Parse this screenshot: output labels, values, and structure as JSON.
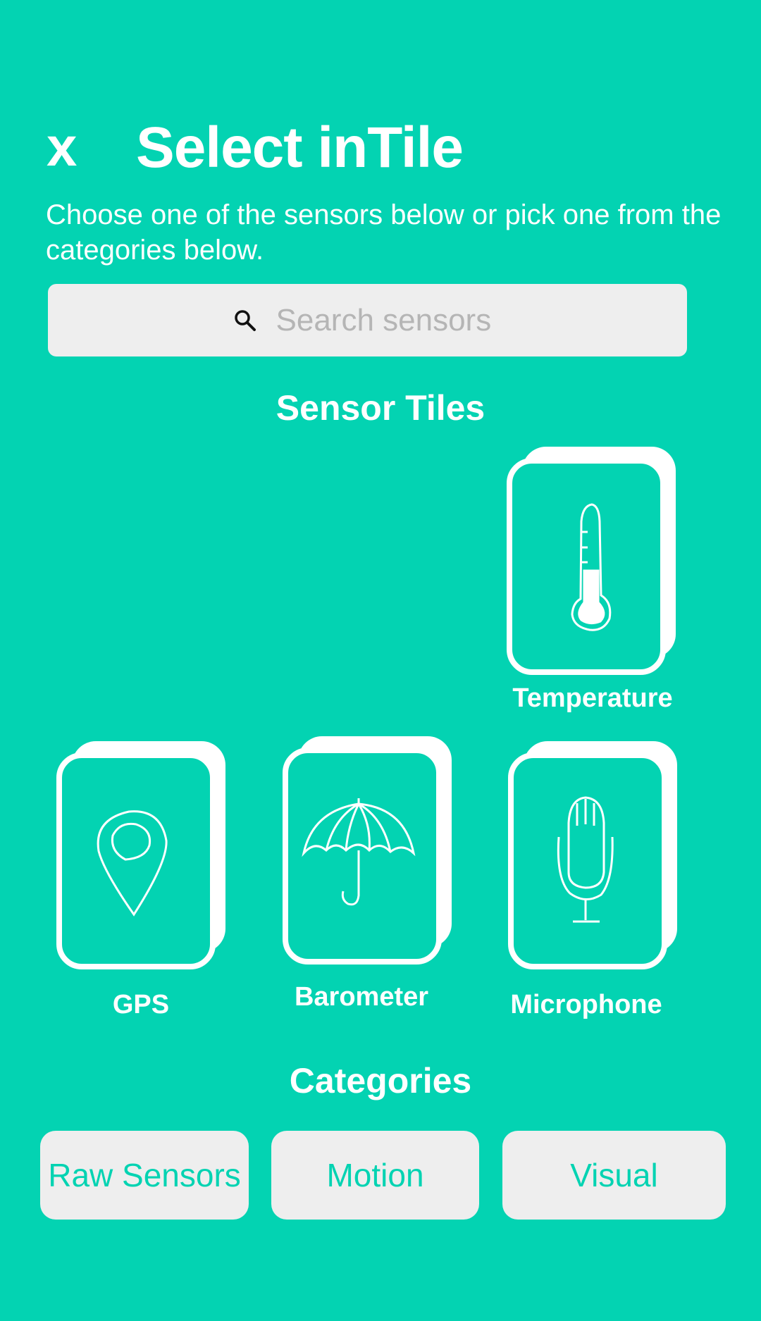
{
  "header": {
    "close_label": "x",
    "title": "Select inTile",
    "subtitle": "Choose one of the sensors below or pick one from the categories below."
  },
  "search": {
    "placeholder": "Search sensors",
    "icon": "search-icon"
  },
  "sensor_tiles": {
    "heading": "Sensor Tiles",
    "items": [
      {
        "label": "Temperature",
        "icon": "thermometer-icon"
      },
      {
        "label": "GPS",
        "icon": "map-pin-icon"
      },
      {
        "label": "Barometer",
        "icon": "umbrella-icon"
      },
      {
        "label": "Microphone",
        "icon": "microphone-icon"
      }
    ]
  },
  "categories": {
    "heading": "Categories",
    "items": [
      {
        "label": "Raw Sensors"
      },
      {
        "label": "Motion"
      },
      {
        "label": "Visual"
      }
    ]
  },
  "colors": {
    "background": "#03d3b2",
    "button": "#eeeeee",
    "text": "#ffffff"
  }
}
